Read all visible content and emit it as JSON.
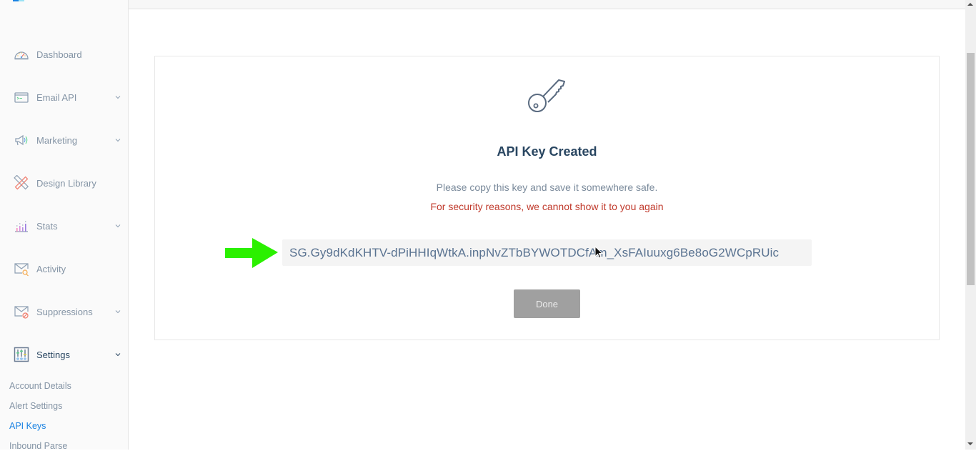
{
  "sidebar": {
    "items": [
      {
        "label": "Dashboard",
        "icon": "dashboard-gauge-icon",
        "has_chevron": false
      },
      {
        "label": "Email API",
        "icon": "terminal-window-icon",
        "has_chevron": true
      },
      {
        "label": "Marketing",
        "icon": "megaphone-icon",
        "has_chevron": true
      },
      {
        "label": "Design Library",
        "icon": "pencil-ruler-icon",
        "has_chevron": false
      },
      {
        "label": "Stats",
        "icon": "bar-chart-icon",
        "has_chevron": true
      },
      {
        "label": "Activity",
        "icon": "envelope-search-icon",
        "has_chevron": false
      },
      {
        "label": "Suppressions",
        "icon": "envelope-block-icon",
        "has_chevron": true
      },
      {
        "label": "Settings",
        "icon": "sliders-icon",
        "has_chevron": true,
        "expanded": true
      }
    ],
    "settings_subitems": [
      {
        "label": "Account Details",
        "active": false
      },
      {
        "label": "Alert Settings",
        "active": false
      },
      {
        "label": "API Keys",
        "active": true
      },
      {
        "label": "Inbound Parse",
        "active": false
      }
    ]
  },
  "main": {
    "icon": "key-icon",
    "title": "API Key Created",
    "message": "Please copy this key and save it somewhere safe.",
    "warning": "For security reasons, we cannot show it to you again",
    "api_key": "SG.Gy9dKdKHTV-dPiHHIqWtkA.inpNvZTbBYWOTDCfAm_XsFAIuuxg6Be8oG2WCpRUic",
    "done_label": "Done",
    "annotation": "green-arrow-pointer"
  },
  "colors": {
    "accent": "#1a82e2",
    "title": "#294661",
    "warning": "#c0392b",
    "arrow": "#2bf000",
    "done_button": "#a0a0a0"
  }
}
